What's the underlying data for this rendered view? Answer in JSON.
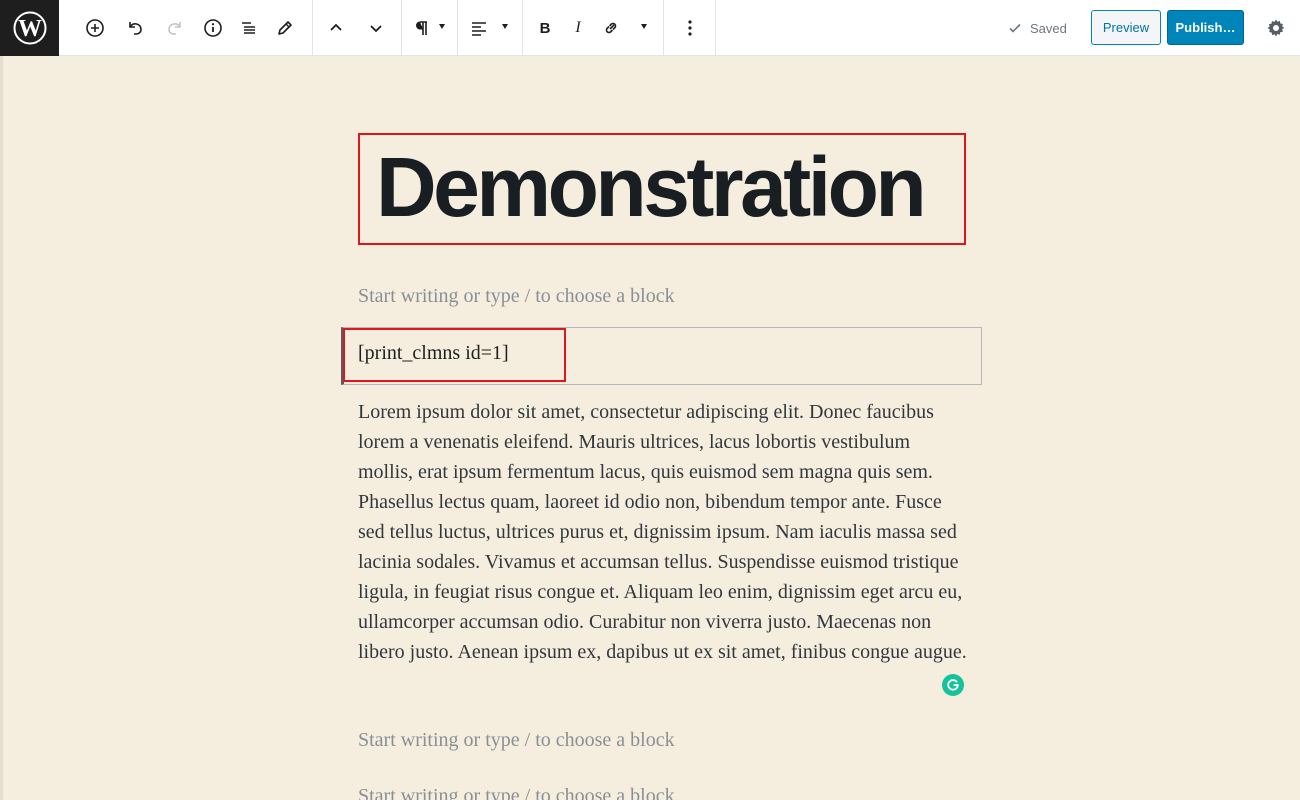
{
  "toolbar": {
    "logo_icon": "wordpress-logo-icon",
    "icons": {
      "add": "plus-circle-icon",
      "undo": "undo-icon",
      "redo": "redo-icon",
      "info": "info-icon",
      "outline": "list-outline-icon",
      "tools": "pencil-icon",
      "move_up": "chevron-up-icon",
      "move_down": "chevron-down-icon",
      "paragraph": "paragraph-icon",
      "align": "align-left-icon",
      "bold": "bold-icon",
      "italic": "italic-icon",
      "link": "link-icon",
      "more": "more-vertical-icon",
      "settings": "gear-icon"
    },
    "bold_glyph": "B",
    "italic_glyph": "I",
    "saved_label": "Saved",
    "preview_label": "Preview",
    "publish_label": "Publish…"
  },
  "editor": {
    "title": "Demonstration",
    "placeholder_1": "Start writing or type / to choose a block",
    "shortcode": "[print_clmns id=1]",
    "paragraph": "Lorem ipsum dolor sit amet, consectetur adipiscing elit. Donec faucibus lorem a venenatis eleifend. Mauris ultrices, lacus lobortis vestibulum mollis, erat ipsum fermentum lacus, quis euismod sem magna quis sem. Phasellus lectus quam, laoreet id odio non, bibendum tempor ante. Fusce sed tellus luctus, ultrices purus et, dignissim ipsum. Nam iaculis massa sed lacinia sodales. Vivamus et accumsan tellus. Suspendisse euismod tristique ligula, in feugiat risus congue et. Aliquam leo enim, dignissim eget arcu eu, ullamcorper accumsan odio. Curabitur non viverra justo. Maecenas non libero justo. Aenean ipsum ex, dapibus ut ex sit amet, finibus congue augue.",
    "placeholder_2": "Start writing or type / to choose a block",
    "placeholder_3": "Start writing or type / to choose a block"
  },
  "colors": {
    "canvas_bg": "#f5eedf",
    "highlight_red": "#e0161d",
    "publish_blue": "#0085ba",
    "grammarly_green": "#15c39a"
  }
}
